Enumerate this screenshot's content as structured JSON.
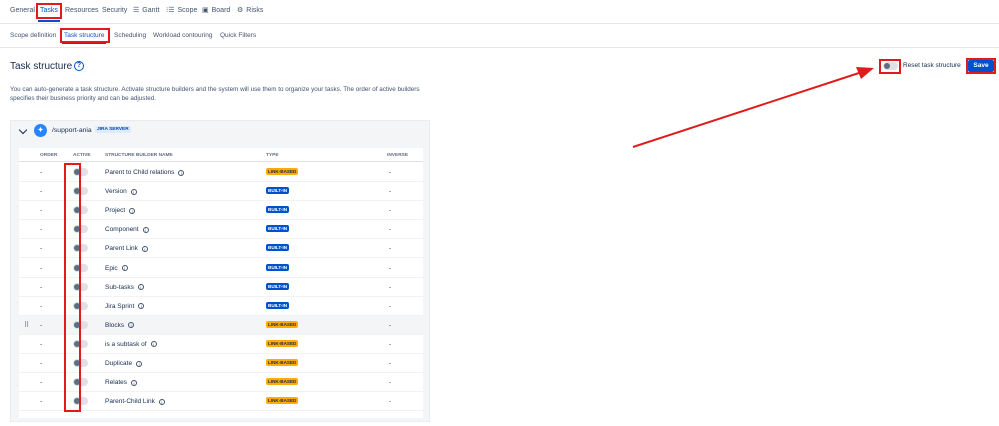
{
  "top_nav": {
    "items": [
      {
        "label": "General"
      },
      {
        "label": "Tasks"
      },
      {
        "label": "Resources"
      },
      {
        "label": "Security"
      },
      {
        "label": "Gantt",
        "icon": "list-lines-icon"
      },
      {
        "label": "Scope",
        "icon": "list-bullets-icon"
      },
      {
        "label": "Board",
        "icon": "board-icon"
      },
      {
        "label": "Risks",
        "icon": "risk-gear-icon"
      }
    ],
    "active": "Tasks"
  },
  "sub_nav": {
    "items": [
      {
        "label": "Scope definition"
      },
      {
        "label": "Task structure"
      },
      {
        "label": "Scheduling"
      },
      {
        "label": "Workload contouring"
      },
      {
        "label": "Quick Filters"
      }
    ],
    "active": "Task structure"
  },
  "page": {
    "title": "Task structure",
    "description": "You can auto-generate a task structure. Activate structure builders and the system will use them to organize your tasks. The order of active builders specifies their business priority and can be adjusted.",
    "reset_label": "Reset task structure",
    "save_label": "Save"
  },
  "project": {
    "name": "/support-ania",
    "badge": "JIRA SERVER"
  },
  "table": {
    "headers": {
      "order": "ORDER",
      "active": "ACTIVE",
      "name": "STRUCTURE BUILDER NAME",
      "type": "TYPE",
      "inverse": "INVERSE"
    },
    "rows": [
      {
        "order": "-",
        "name": "Parent to Child relations",
        "type": "LINK-BASED",
        "inverse": "-"
      },
      {
        "order": "-",
        "name": "Version",
        "type": "BUILT-IN",
        "inverse": "-"
      },
      {
        "order": "-",
        "name": "Project",
        "type": "BUILT-IN",
        "inverse": "-"
      },
      {
        "order": "-",
        "name": "Component",
        "type": "BUILT-IN",
        "inverse": "-"
      },
      {
        "order": "-",
        "name": "Parent Link",
        "type": "BUILT-IN",
        "inverse": "-"
      },
      {
        "order": "-",
        "name": "Epic",
        "type": "BUILT-IN",
        "inverse": "-"
      },
      {
        "order": "-",
        "name": "Sub-tasks",
        "type": "BUILT-IN",
        "inverse": "-"
      },
      {
        "order": "-",
        "name": "Jira Sprint",
        "type": "BUILT-IN",
        "inverse": "-"
      },
      {
        "order": "-",
        "name": "Blocks",
        "type": "LINK-BASED",
        "inverse": "-"
      },
      {
        "order": "-",
        "name": "is a subtask of",
        "type": "LINK-BASED",
        "inverse": "-"
      },
      {
        "order": "-",
        "name": "Duplicate",
        "type": "LINK-BASED",
        "inverse": "-"
      },
      {
        "order": "-",
        "name": "Relates",
        "type": "LINK-BASED",
        "inverse": "-"
      },
      {
        "order": "-",
        "name": "Parent-Child Link",
        "type": "LINK-BASED",
        "inverse": "-"
      }
    ]
  },
  "colors": {
    "accent": "#0052cc",
    "annotation": "#e01b1b",
    "link_badge": "#ffab00",
    "builtin_badge": "#0052cc"
  }
}
